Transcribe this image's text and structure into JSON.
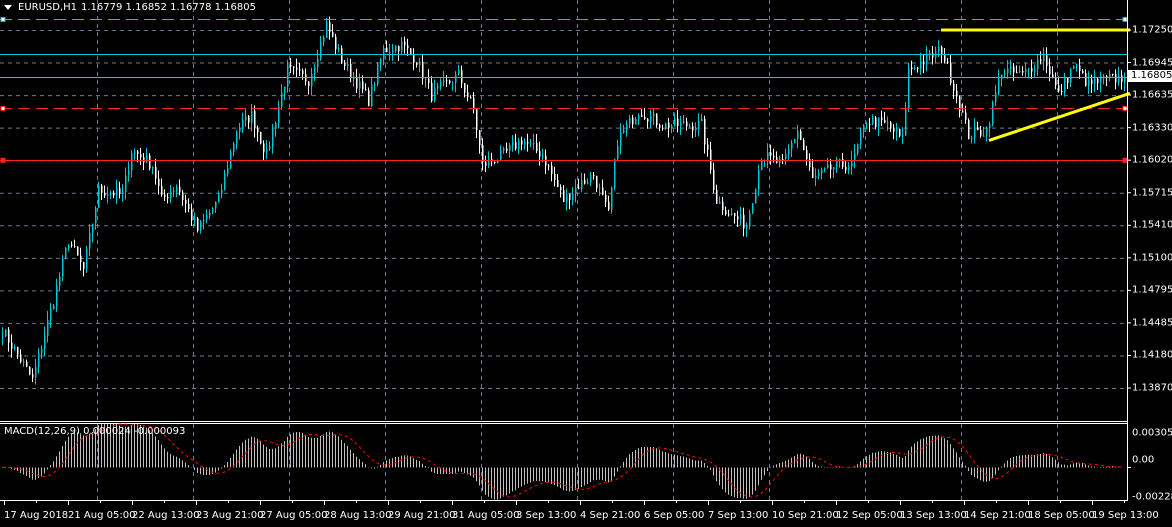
{
  "header": {
    "symbol": "EURUSD,H1",
    "ohlc": "1.16779 1.16852 1.16778 1.16805"
  },
  "macd": {
    "label": "MACD(12,26,9) 0.000024 -0.000093",
    "axis": [
      "0.00305",
      "0.00",
      "-0.002282"
    ],
    "range": [
      -0.002282,
      0.00305
    ]
  },
  "price_axis": {
    "labels": [
      "1.17250",
      "1.16945",
      "1.16635",
      "1.16330",
      "1.16020",
      "1.15715",
      "1.15410",
      "1.15100",
      "1.14795",
      "1.14485",
      "1.14180",
      "1.13870"
    ],
    "current": "1.16805",
    "range": [
      1.1387,
      1.1725
    ]
  },
  "time_axis": [
    "17 Aug 2018",
    "21 Aug 05:00",
    "22 Aug 13:00",
    "23 Aug 21:00",
    "27 Aug 05:00",
    "28 Aug 13:00",
    "29 Aug 21:00",
    "31 Aug 05:00",
    "3 Sep 13:00",
    "4 Sep 21:00",
    "6 Sep 05:00",
    "7 Sep 13:00",
    "10 Sep 21:00",
    "12 Sep 05:00",
    "13 Sep 13:00",
    "14 Sep 21:00",
    "18 Sep 05:00",
    "19 Sep 13:00"
  ],
  "colors": {
    "bull": "#00c8d2",
    "bear": "#ffffff",
    "grid": "#6b7b8c",
    "cyan_line": "#00c8d2",
    "red_line": "#ff2020",
    "trend": "#ffff00",
    "macd_hist": "#c0c0c0",
    "macd_signal": "#ff0000"
  },
  "chart_data": {
    "type": "candlestick",
    "bars": 375,
    "close_path": [
      [
        0,
        1.14418
      ],
      [
        10,
        1.13946
      ],
      [
        17,
        1.14701
      ],
      [
        22,
        1.15268
      ],
      [
        27,
        1.14984
      ],
      [
        32,
        1.1574
      ],
      [
        40,
        1.15692
      ],
      [
        43,
        1.16117
      ],
      [
        50,
        1.15976
      ],
      [
        53,
        1.15645
      ],
      [
        58,
        1.15787
      ],
      [
        65,
        1.15362
      ],
      [
        72,
        1.15645
      ],
      [
        78,
        1.16306
      ],
      [
        83,
        1.16448
      ],
      [
        88,
        1.1607
      ],
      [
        95,
        1.16872
      ],
      [
        102,
        1.16778
      ],
      [
        108,
        1.17297
      ],
      [
        113,
        1.16967
      ],
      [
        122,
        1.16589
      ],
      [
        127,
        1.17061
      ],
      [
        133,
        1.17108
      ],
      [
        138,
        1.16967
      ],
      [
        143,
        1.16636
      ],
      [
        152,
        1.16825
      ],
      [
        157,
        1.16495
      ],
      [
        160,
        1.15976
      ],
      [
        167,
        1.1607
      ],
      [
        173,
        1.16212
      ],
      [
        180,
        1.1607
      ],
      [
        187,
        1.15645
      ],
      [
        192,
        1.15787
      ],
      [
        197,
        1.15881
      ],
      [
        202,
        1.15504
      ],
      [
        205,
        1.16212
      ],
      [
        212,
        1.16495
      ],
      [
        220,
        1.16353
      ],
      [
        233,
        1.16353
      ],
      [
        238,
        1.15645
      ],
      [
        243,
        1.15504
      ],
      [
        248,
        1.15409
      ],
      [
        253,
        1.1607
      ],
      [
        260,
        1.15976
      ],
      [
        265,
        1.16306
      ],
      [
        270,
        1.15834
      ],
      [
        278,
        1.15976
      ],
      [
        283,
        1.15976
      ],
      [
        288,
        1.164
      ],
      [
        295,
        1.16353
      ],
      [
        300,
        1.16212
      ],
      [
        302,
        1.16872
      ],
      [
        313,
        1.17061
      ],
      [
        318,
        1.16636
      ],
      [
        322,
        1.16259
      ],
      [
        328,
        1.16306
      ],
      [
        333,
        1.16872
      ],
      [
        340,
        1.16825
      ],
      [
        347,
        1.17014
      ],
      [
        352,
        1.16636
      ],
      [
        357,
        1.1692
      ],
      [
        362,
        1.16731
      ],
      [
        367,
        1.16778
      ],
      [
        374,
        1.16805
      ]
    ],
    "hlines": [
      {
        "price": 1.1735,
        "style": "dashed",
        "color": "#00c8d2"
      },
      {
        "price": 1.17023,
        "style": "solid",
        "color": "#00c8d2"
      },
      {
        "price": 1.16805,
        "style": "solid",
        "color": "#8c9aa8"
      },
      {
        "price": 1.1651,
        "style": "dashed",
        "color": "#ff2020"
      },
      {
        "price": 1.1602,
        "style": "solid",
        "color": "#ff2020"
      }
    ],
    "trendlines": [
      {
        "from": [
          313,
          1.1725
        ],
        "to": [
          376,
          1.1725
        ],
        "color": "#ffff00"
      },
      {
        "from": [
          329,
          1.16207
        ],
        "to": [
          376,
          1.16652
        ],
        "color": "#ffff00"
      }
    ]
  }
}
